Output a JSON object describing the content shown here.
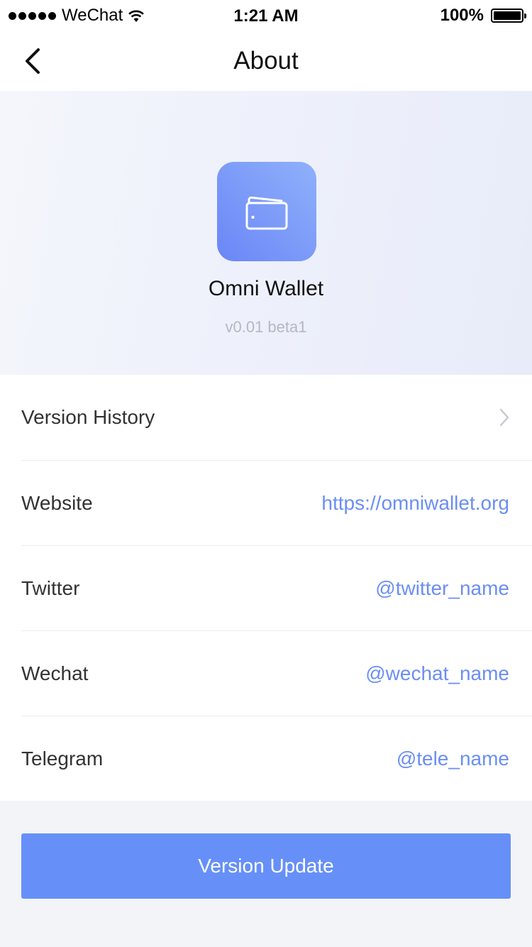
{
  "status_bar": {
    "carrier": "WeChat",
    "time": "1:21 AM",
    "battery": "100%",
    "icons": [
      "signal-dots-icon",
      "wifi-icon",
      "battery-icon"
    ]
  },
  "nav": {
    "back_icon": "chevron-left-icon",
    "title": "About"
  },
  "app": {
    "icon": "wallet-icon",
    "name": "Omni Wallet",
    "version": "v0.01 beta1"
  },
  "list": {
    "items": [
      {
        "label": "Version History",
        "value": "",
        "icon": "chevron-right-icon"
      },
      {
        "label": "Website",
        "value": "https://omniwallet.org"
      },
      {
        "label": "Twitter",
        "value": "@twitter_name"
      },
      {
        "label": "Wechat",
        "value": "@wechat_name"
      },
      {
        "label": "Telegram",
        "value": "@tele_name"
      }
    ]
  },
  "update_button": {
    "label": "Version Update"
  },
  "colors": {
    "accent": "#6690f8",
    "link": "#6b8ef3",
    "background": "#f3f4f8",
    "muted_text": "#b4b8c2"
  }
}
